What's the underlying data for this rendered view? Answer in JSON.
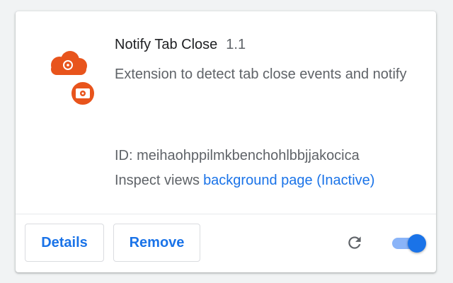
{
  "extension": {
    "name": "Notify Tab Close",
    "version": "1.1",
    "description": "Extension to detect tab close events and notify",
    "id_text": "ID: meihaohppilmkbenchohlbbjjakocica",
    "inspect_label": "Inspect views",
    "inspect_link": "background page (Inactive)",
    "icon": "orange-cloud-with-red-camera-badge-icon",
    "enabled": true
  },
  "actions": {
    "details_label": "Details",
    "remove_label": "Remove",
    "reload_icon": "reload-icon"
  },
  "colors": {
    "accent": "#1a73e8",
    "toggle_track": "#8ab4f8",
    "icon_orange": "#e8541c",
    "text_primary": "#202124",
    "text_secondary": "#5f6368",
    "background": "#f1f3f4"
  }
}
